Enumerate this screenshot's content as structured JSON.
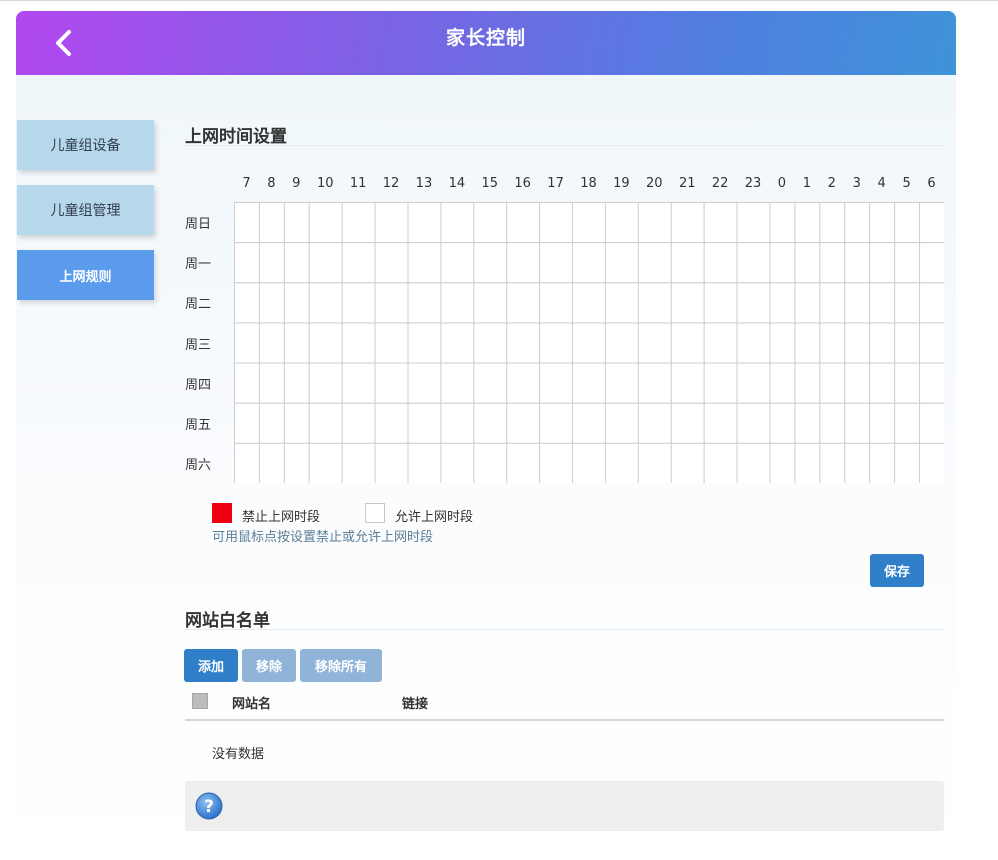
{
  "header": {
    "title": "家长控制",
    "back_icon": "chevron-left-icon"
  },
  "sidebar": {
    "items": [
      {
        "label": "儿童组设备",
        "active": false
      },
      {
        "label": "儿童组管理",
        "active": false
      },
      {
        "label": "上网规则",
        "active": true
      }
    ]
  },
  "schedule": {
    "title": "上网时间设置",
    "hours": [
      "7",
      "8",
      "9",
      "10",
      "11",
      "12",
      "13",
      "14",
      "15",
      "16",
      "17",
      "18",
      "19",
      "20",
      "21",
      "22",
      "23",
      "0",
      "1",
      "2",
      "3",
      "4",
      "5",
      "6"
    ],
    "days": [
      "周日",
      "周一",
      "周二",
      "周三",
      "周四",
      "周五",
      "周六"
    ],
    "legend_block": "禁止上网时段",
    "legend_allow": "允许上网时段",
    "hint": "可用鼠标点按设置禁止或允许上网时段",
    "save_label": "保存",
    "colors": {
      "blocked": "#ee0011",
      "allowed": "#ffffff"
    }
  },
  "whitelist": {
    "title": "网站白名单",
    "add_label": "添加",
    "remove_label": "移除",
    "remove_all_label": "移除所有",
    "col_name": "网站名",
    "col_link": "链接",
    "empty_text": "没有数据"
  },
  "help": {
    "icon": "question-icon"
  }
}
